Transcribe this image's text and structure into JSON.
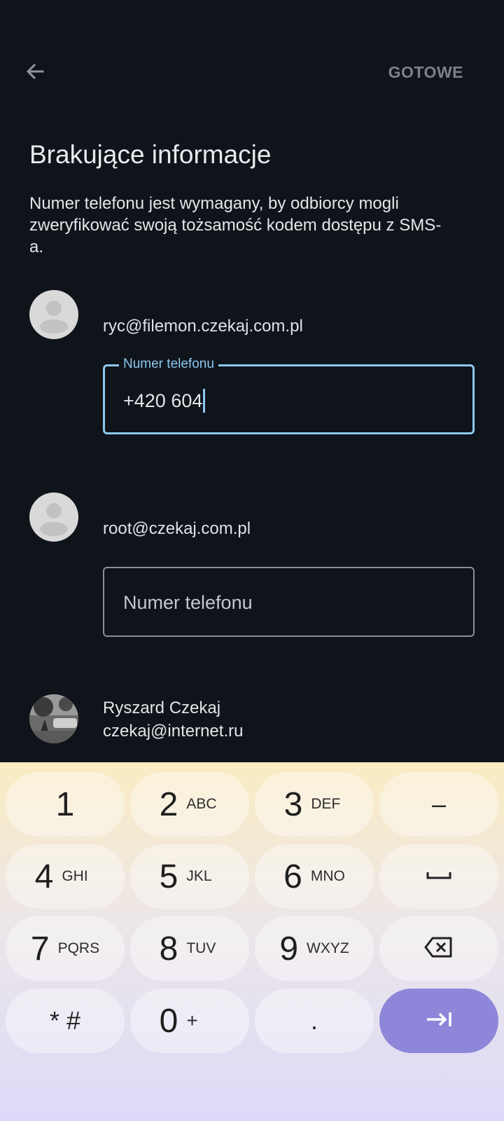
{
  "header": {
    "back_icon": "arrow-left-icon",
    "done_label": "GOTOWE"
  },
  "title": "Brakujące informacje",
  "description": "Numer telefonu jest wymagany, by odbiorcy mogli zweryfikować swoją tożsamość kodem dostępu z SMS-a.",
  "recipients": [
    {
      "email": "ryc@filemon.czekaj.com.pl",
      "phone_label": "Numer telefonu",
      "phone_value": "+420 604"
    },
    {
      "email": "root@czekaj.com.pl",
      "phone_placeholder": "Numer telefonu"
    }
  ],
  "contact": {
    "name": "Ryszard Czekaj",
    "email": "czekaj@internet.ru"
  },
  "keyboard": {
    "keys": [
      {
        "num": "1",
        "letters": ""
      },
      {
        "num": "2",
        "letters": "ABC"
      },
      {
        "num": "3",
        "letters": "DEF"
      },
      {
        "num": "–",
        "letters": ""
      },
      {
        "num": "4",
        "letters": "GHI"
      },
      {
        "num": "5",
        "letters": "JKL"
      },
      {
        "num": "6",
        "letters": "MNO"
      },
      {
        "num": "space",
        "letters": ""
      },
      {
        "num": "7",
        "letters": "PQRS"
      },
      {
        "num": "8",
        "letters": "TUV"
      },
      {
        "num": "9",
        "letters": "WXYZ"
      },
      {
        "num": "backspace",
        "letters": ""
      },
      {
        "num": "* #",
        "letters": ""
      },
      {
        "num": "0",
        "letters": "+"
      },
      {
        "num": ".",
        "letters": ""
      },
      {
        "num": "next",
        "letters": ""
      }
    ]
  }
}
